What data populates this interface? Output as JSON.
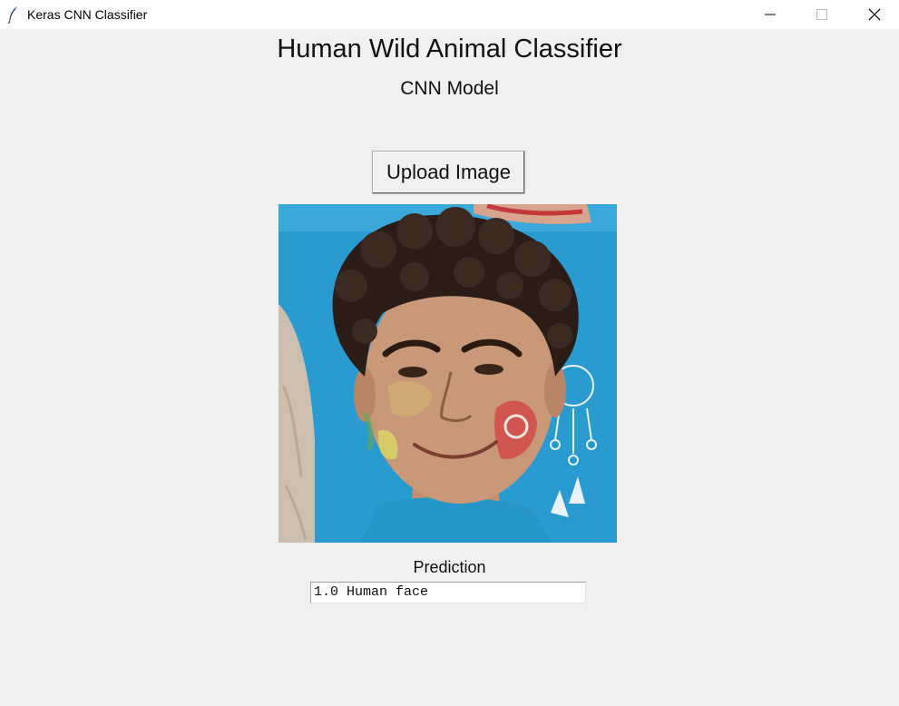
{
  "window": {
    "title": "Keras CNN Classifier",
    "icon": "feather-icon"
  },
  "header": {
    "title": "Human Wild Animal Classifier",
    "subtitle": "CNN Model"
  },
  "upload": {
    "label": "Upload Image"
  },
  "preview": {
    "description_icon": "uploaded-photo"
  },
  "prediction": {
    "label": "Prediction",
    "value": "1.0 Human face"
  },
  "colors": {
    "background": "#f0f0f0",
    "titlebar": "#ffffff",
    "shirt": "#2ea0d0"
  }
}
